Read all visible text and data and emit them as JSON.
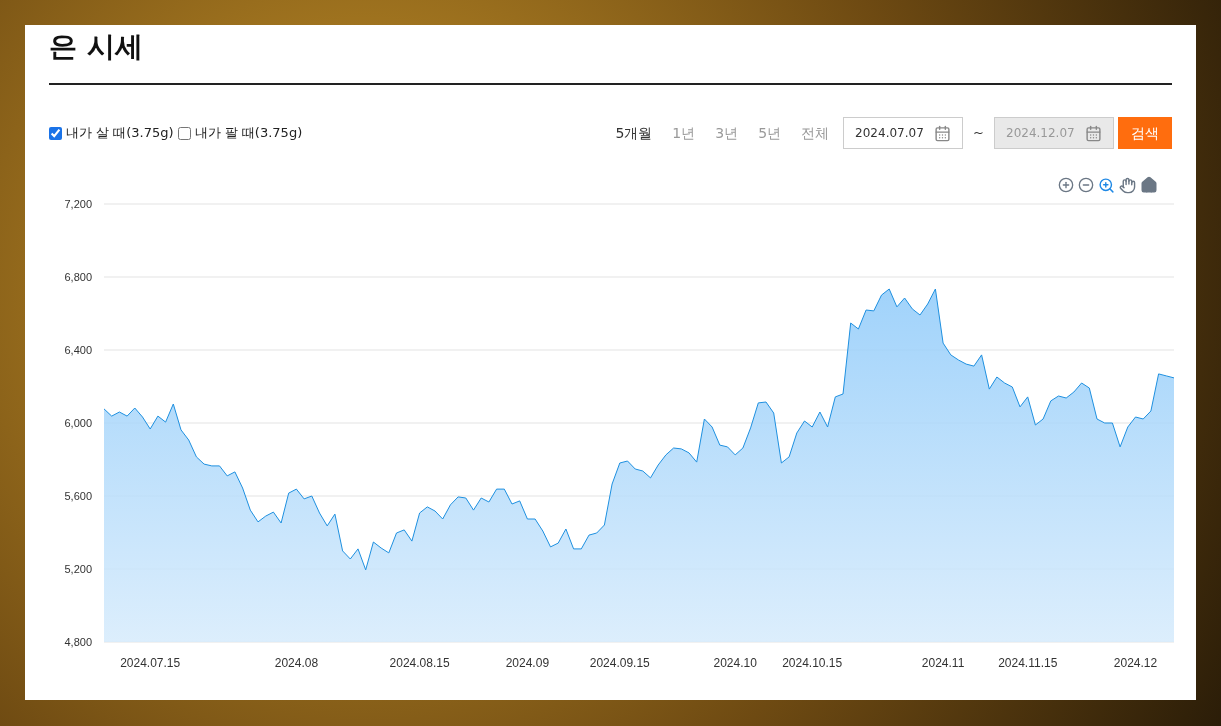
{
  "title": "은 시세",
  "filters": [
    {
      "label": "내가 살 때(3.75g)",
      "checked": true
    },
    {
      "label": "내가 팔 때(3.75g)",
      "checked": false
    }
  ],
  "periods": [
    {
      "label": "5개월",
      "selected": true
    },
    {
      "label": "1년",
      "selected": false
    },
    {
      "label": "3년",
      "selected": false
    },
    {
      "label": "5년",
      "selected": false
    },
    {
      "label": "전체",
      "selected": false
    }
  ],
  "date_range": {
    "start": {
      "value": "2024.07.07",
      "disabled": false
    },
    "separator": "~",
    "end": {
      "value": "2024.12.07",
      "disabled": true
    }
  },
  "search_button": "검색",
  "chart_data": {
    "type": "area",
    "grid": true,
    "ylim": [
      4800,
      7200
    ],
    "yticks": [
      {
        "value": 4800,
        "label": "4,800"
      },
      {
        "value": 5200,
        "label": "5,200"
      },
      {
        "value": 5600,
        "label": "5,600"
      },
      {
        "value": 6000,
        "label": "6,000"
      },
      {
        "value": 6400,
        "label": "6,400"
      },
      {
        "value": 6800,
        "label": "6,800"
      },
      {
        "value": 7200,
        "label": "7,200"
      }
    ],
    "categories": [
      null,
      null,
      null,
      null,
      null,
      null,
      "2024.07.15",
      null,
      null,
      null,
      null,
      null,
      null,
      null,
      null,
      null,
      null,
      null,
      null,
      null,
      null,
      null,
      null,
      null,
      null,
      "2024.08",
      null,
      null,
      null,
      null,
      null,
      null,
      null,
      null,
      null,
      null,
      null,
      null,
      null,
      null,
      null,
      "2024.08.15",
      null,
      null,
      null,
      null,
      null,
      null,
      null,
      null,
      null,
      null,
      null,
      null,
      null,
      "2024.09",
      null,
      null,
      null,
      null,
      null,
      null,
      null,
      null,
      null,
      null,
      null,
      "2024.09.15",
      null,
      null,
      null,
      null,
      null,
      null,
      null,
      null,
      null,
      null,
      null,
      null,
      null,
      null,
      "2024.10",
      null,
      null,
      null,
      null,
      null,
      null,
      null,
      null,
      null,
      "2024.10.15",
      null,
      null,
      null,
      null,
      null,
      null,
      null,
      null,
      null,
      null,
      null,
      null,
      null,
      null,
      null,
      null,
      "2024.11",
      null,
      null,
      null,
      null,
      null,
      null,
      null,
      null,
      null,
      null,
      "2024.11.15",
      null,
      null,
      null,
      null,
      null,
      null,
      null,
      null,
      null,
      null,
      null,
      null,
      null,
      "2024.12",
      null,
      null,
      null,
      null,
      null
    ],
    "series": [
      {
        "color": "#1e90e0",
        "values": [
          6077,
          6038,
          6060,
          6038,
          6082,
          6033,
          5967,
          6038,
          6005,
          6104,
          5962,
          5907,
          5814,
          5775,
          5765,
          5765,
          5710,
          5732,
          5644,
          5523,
          5458,
          5490,
          5512,
          5452,
          5616,
          5638,
          5584,
          5600,
          5507,
          5436,
          5501,
          5299,
          5255,
          5310,
          5195,
          5348,
          5315,
          5288,
          5397,
          5414,
          5353,
          5507,
          5540,
          5518,
          5474,
          5551,
          5595,
          5589,
          5523,
          5589,
          5567,
          5638,
          5638,
          5556,
          5573,
          5474,
          5474,
          5408,
          5321,
          5342,
          5419,
          5310,
          5310,
          5386,
          5397,
          5441,
          5666,
          5781,
          5792,
          5748,
          5737,
          5699,
          5770,
          5825,
          5863,
          5858,
          5836,
          5786,
          6022,
          5978,
          5879,
          5869,
          5825,
          5863,
          5973,
          6110,
          6115,
          6055,
          5781,
          5814,
          5945,
          6011,
          5978,
          6060,
          5978,
          6143,
          6159,
          6548,
          6515,
          6619,
          6614,
          6701,
          6734,
          6636,
          6685,
          6625,
          6592,
          6652,
          6734,
          6438,
          6373,
          6345,
          6323,
          6312,
          6373,
          6186,
          6252,
          6219,
          6197,
          6088,
          6143,
          5989,
          6022,
          6121,
          6148,
          6137,
          6170,
          6219,
          6192,
          6022,
          6000,
          6000,
          5869,
          5978,
          6033,
          6022,
          6066,
          6269,
          6258,
          6247
        ]
      }
    ]
  }
}
